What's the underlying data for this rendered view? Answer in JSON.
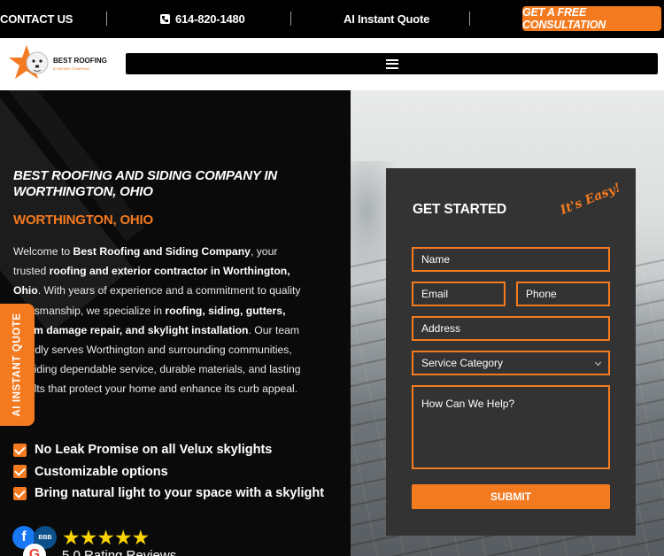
{
  "topbar": {
    "contact_label": "CONTACT US",
    "phone": "614-820-1480",
    "quote_label": "AI Instant Quote",
    "cta_label": "GET A FREE CONSULTATION"
  },
  "header": {
    "logo_name": "BEST ROOFING",
    "logo_sub": "& SIDING COMPANY",
    "menu_icon": "hamburger-icon"
  },
  "hero": {
    "heading": "BEST ROOFING AND SIDING COMPANY IN WORTHINGTON, OHIO",
    "location": "WORTHINGTON, OHIO",
    "paragraph": {
      "p1": "Welcome to ",
      "b1": "Best Roofing and Siding Company",
      "p2": ", your trusted ",
      "b2": "roofing and exterior contractor in Worthington, Ohio",
      "p3": ". With years of experience and a commitment to quality craftsmanship, we specialize in ",
      "b3": "roofing, siding, gutters, storm damage repair, and skylight installation",
      "p4": ". Our team proudly serves Worthington and surrounding communities, providing dependable service, durable materials, and lasting results that protect your home and enhance its curb appeal."
    },
    "checklist": [
      "No Leak Promise on all Velux skylights",
      "Customizable options",
      "Bring natural light to your space with a skylight"
    ],
    "stars": "★★★★★",
    "rating_text": "5.0 Rating Reviews"
  },
  "side_tab": {
    "label": "AI INSTANT QUOTE"
  },
  "form": {
    "title": "GET STARTED",
    "tagline": "It's Easy!",
    "name_placeholder": "Name",
    "email_placeholder": "Email",
    "phone_placeholder": "Phone",
    "address_placeholder": "Address",
    "service_selected": "Service Category",
    "message_placeholder": "How Can We Help?",
    "submit_label": "SUBMIT"
  },
  "colors": {
    "accent": "#f47a20",
    "card": "#333333",
    "dark": "#0a0a0a"
  }
}
